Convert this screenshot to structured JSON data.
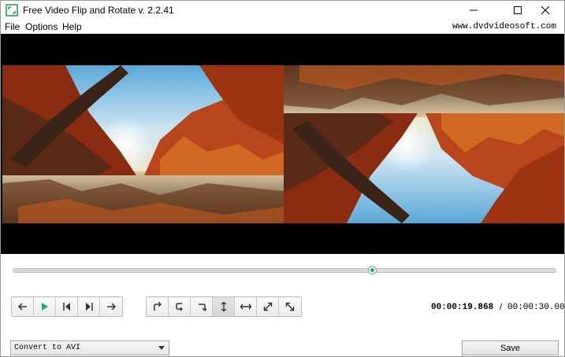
{
  "window": {
    "title": "Free Video Flip and Rotate v. 2.2.41",
    "controls": {
      "minimize_icon": "minimize-icon",
      "maximize_icon": "maximize-icon",
      "close_icon": "close-icon"
    }
  },
  "menu": {
    "items": [
      "File",
      "Options",
      "Help"
    ],
    "site": "www.dvdvideosoft.com"
  },
  "player": {
    "seek_progress_fraction": 0.663,
    "playback_buttons": [
      "step-back-icon",
      "play-icon",
      "previous-frame-icon",
      "next-frame-icon",
      "step-forward-icon"
    ],
    "transform_buttons": [
      "rotate-left-icon",
      "rotate-180-icon",
      "rotate-right-icon",
      "flip-vertical-icon",
      "flip-horizontal-icon",
      "transpose-icon",
      "transverse-icon"
    ],
    "active_transform": "flip-vertical-icon",
    "time_current": "00:00:19.868",
    "time_separator": "/",
    "time_total": "00:00:30.000"
  },
  "bottom": {
    "format_selected": "Convert to AVI",
    "save_label": "Save"
  },
  "colors": {
    "accent": "#1fae6f",
    "video_background": "#000000"
  }
}
